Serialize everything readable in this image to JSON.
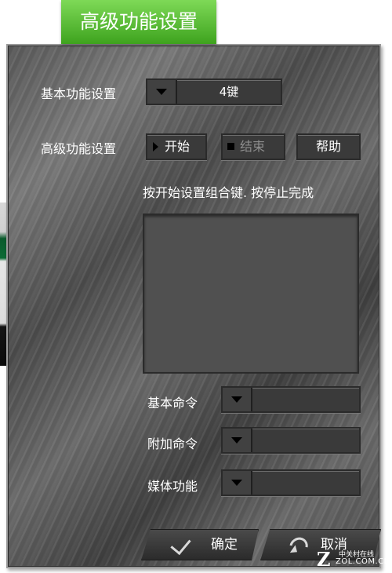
{
  "title": "高级功能设置",
  "basic_function": {
    "label": "基本功能设置",
    "selected": "4键"
  },
  "advanced_function": {
    "label": "高级功能设置",
    "start_label": "开始",
    "end_label": "结束",
    "help_label": "帮助"
  },
  "instruction": "按开始设置组合键. 按停止完成",
  "commands": {
    "basic_label": "基本命令",
    "basic_value": "",
    "additional_label": "附加命令",
    "additional_value": "",
    "media_label": "媒体功能",
    "media_value": ""
  },
  "footer": {
    "ok_label": "确定",
    "cancel_label": "取消"
  },
  "watermark": {
    "logo": "Z",
    "site_cn": "中关村在线",
    "domain": "ZOL.COM.CN"
  },
  "colors": {
    "title_green": "#5bbf3a",
    "panel_gray": "#5a5a5a"
  }
}
